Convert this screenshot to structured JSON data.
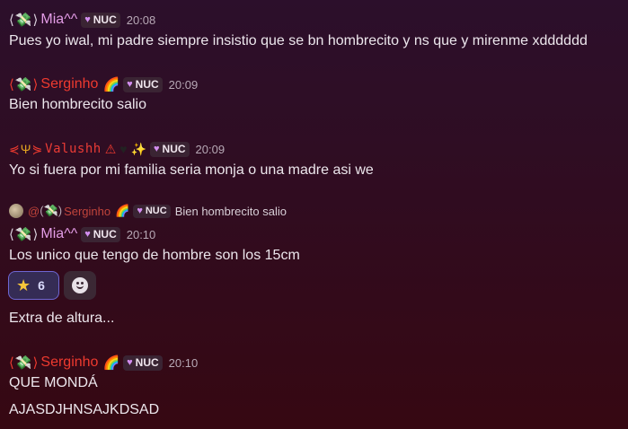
{
  "messages": [
    {
      "user": "Mia^^",
      "tag": "NUC",
      "time": "20:08",
      "lines": [
        "Pues yo iwal, mi padre siempre insistio que se bn hombrecito y ns que y mirenme xdddddd"
      ]
    },
    {
      "user": "Serginho",
      "tag": "NUC",
      "time": "20:09",
      "lines": [
        "Bien hombrecito salio"
      ]
    },
    {
      "user": "Valushh",
      "tag": "NUC",
      "time": "20:09",
      "lines": [
        "Yo si fuera por mi familia seria monja o una madre asi we"
      ]
    },
    {
      "reply": {
        "mention": "@",
        "user": "Serginho",
        "tag": "NUC",
        "text": "Bien hombrecito salio"
      },
      "user": "Mia^^",
      "tag": "NUC",
      "time": "20:10",
      "lines": [
        "Los unico que tengo de hombre son los 15cm",
        "Extra de altura..."
      ],
      "reactions": [
        {
          "emoji": "star-icon",
          "count": "6"
        }
      ]
    },
    {
      "user": "Serginho",
      "tag": "NUC",
      "time": "20:10",
      "lines": [
        "QUE MONDÁ",
        "AJASDJHNSAJKDSAD"
      ]
    }
  ],
  "colors": {
    "mia": "#e39ce6",
    "serginho": "#ee3a2f",
    "valushh": "#ea3b35",
    "reaction_active_border": "#6e66d2"
  }
}
